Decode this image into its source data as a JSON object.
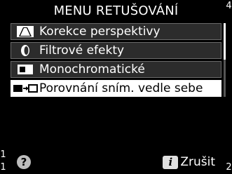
{
  "menu": {
    "title": "MENU RETUŠOVÁNÍ",
    "items": [
      {
        "label": "Korekce perspektivy",
        "icon": "perspective-icon",
        "selected": false
      },
      {
        "label": "Filtrové efekty",
        "icon": "filter-effects-icon",
        "selected": false
      },
      {
        "label": "Monochromatické",
        "icon": "monochrome-icon",
        "selected": false
      },
      {
        "label": "Porovnání sním. vedle sebe",
        "icon": "side-by-side-icon",
        "selected": true
      }
    ]
  },
  "bottom_bar": {
    "help_symbol": "?",
    "info_symbol": "i",
    "cancel_label": "Zrušit"
  },
  "side_strips": {
    "left_top": "1",
    "left_bottom": "1",
    "right_top": "4",
    "right_bottom": "2"
  },
  "colors": {
    "background": "#000000",
    "item_background": "#2c2c2c",
    "selected_background": "#ffffff",
    "item_border": "#6a6a6a"
  }
}
